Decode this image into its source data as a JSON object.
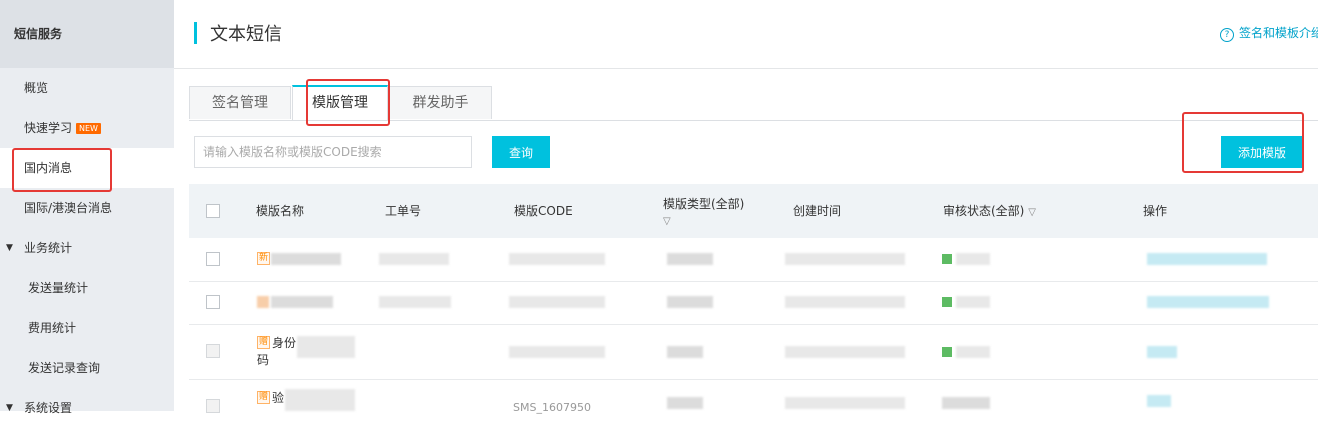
{
  "sidebar": {
    "title": "短信服务",
    "items": [
      {
        "label": "概览"
      },
      {
        "label": "快速学习",
        "badge": "NEW"
      },
      {
        "label": "国内消息"
      },
      {
        "label": "国际/港澳台消息"
      },
      {
        "label": "业务统计"
      },
      {
        "label": "发送量统计"
      },
      {
        "label": "费用统计"
      },
      {
        "label": "发送记录查询"
      },
      {
        "label": "系统设置"
      }
    ]
  },
  "header": {
    "title": "文本短信",
    "help_link": "签名和模板介绍"
  },
  "tabs": [
    {
      "label": "签名管理"
    },
    {
      "label": "模版管理"
    },
    {
      "label": "群发助手"
    }
  ],
  "search": {
    "placeholder": "请输入模版名称或模版CODE搜索",
    "query_label": "查询",
    "add_label": "添加模版"
  },
  "table": {
    "columns": [
      "模版名称",
      "工单号",
      "模版CODE",
      "模版类型(全部)",
      "创建时间",
      "审核状态(全部)",
      "操作"
    ],
    "rows": [
      {
        "tag": "新",
        "name_visible": ""
      },
      {
        "tag": "",
        "name_visible": ""
      },
      {
        "tag": "赠",
        "name_line1": "身份",
        "name_line2": "码"
      },
      {
        "tag": "赠",
        "name_line1": "验",
        "code_partial": "SMS_1607950"
      }
    ]
  },
  "colors": {
    "accent": "#00c1de",
    "highlight": "#e53935",
    "link": "#00a2ca",
    "badge": "#ff6a00"
  }
}
